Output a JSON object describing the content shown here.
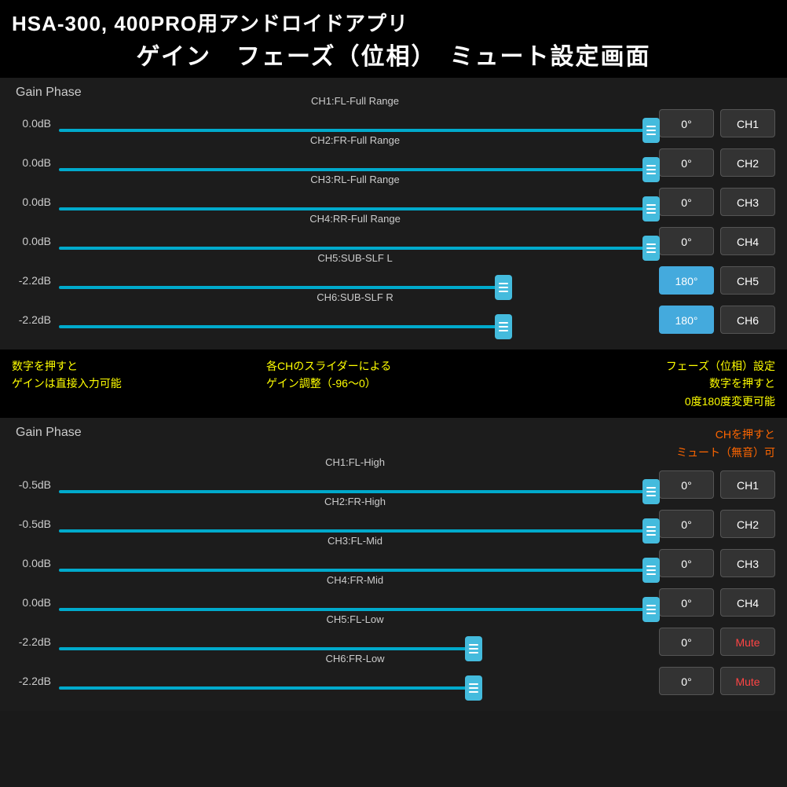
{
  "header": {
    "line1": "HSA-300, 400PRO用アンドロイドアプリ",
    "line2": "ゲイン　フェーズ（位相）　ミュート設定画面"
  },
  "section1": {
    "title": "Gain Phase",
    "channels": [
      {
        "id": "ch1",
        "gain": "0.0dB",
        "label": "CH1:FL-Full Range",
        "phase": "0°",
        "phaseActive": false,
        "chLabel": "CH1",
        "mute": false,
        "sliderType": "full"
      },
      {
        "id": "ch2",
        "gain": "0.0dB",
        "label": "CH2:FR-Full Range",
        "phase": "0°",
        "phaseActive": false,
        "chLabel": "CH2",
        "mute": false,
        "sliderType": "full"
      },
      {
        "id": "ch3",
        "gain": "0.0dB",
        "label": "CH3:RL-Full Range",
        "phase": "0°",
        "phaseActive": false,
        "chLabel": "CH3",
        "mute": false,
        "sliderType": "full"
      },
      {
        "id": "ch4",
        "gain": "0.0dB",
        "label": "CH4:RR-Full Range",
        "phase": "0°",
        "phaseActive": false,
        "chLabel": "CH4",
        "mute": false,
        "sliderType": "full"
      },
      {
        "id": "ch5",
        "gain": "-2.2dB",
        "label": "CH5:SUB-SLF L",
        "phase": "180°",
        "phaseActive": true,
        "chLabel": "CH5",
        "mute": false,
        "sliderType": "sub"
      },
      {
        "id": "ch6",
        "gain": "-2.2dB",
        "label": "CH6:SUB-SLF R",
        "phase": "180°",
        "phaseActive": true,
        "chLabel": "CH6",
        "mute": false,
        "sliderType": "sub"
      }
    ]
  },
  "infoBar": {
    "col1_line1": "数字を押すと",
    "col1_line2": "ゲインは直接入力可能",
    "col2_line1": "各CHのスライダーによる",
    "col2_line2": "ゲイン調整（-96〜0）",
    "col3_line1": "フェーズ（位相）設定",
    "col3_line2": "数字を押すと",
    "col3_line3": "0度180度変更可能"
  },
  "section2": {
    "title": "Gain Phase",
    "muteNote_line1": "CHを押すと",
    "muteNote_line2": "ミュート（無音）可",
    "channels": [
      {
        "id": "ch1b",
        "gain": "-0.5dB",
        "label": "CH1:FL-High",
        "phase": "0°",
        "phaseActive": false,
        "chLabel": "CH1",
        "mute": false,
        "sliderType": "full"
      },
      {
        "id": "ch2b",
        "gain": "-0.5dB",
        "label": "CH2:FR-High",
        "phase": "0°",
        "phaseActive": false,
        "chLabel": "CH2",
        "mute": false,
        "sliderType": "full"
      },
      {
        "id": "ch3b",
        "gain": "0.0dB",
        "label": "CH3:FL-Mid",
        "phase": "0°",
        "phaseActive": false,
        "chLabel": "CH3",
        "mute": false,
        "sliderType": "full"
      },
      {
        "id": "ch4b",
        "gain": "0.0dB",
        "label": "CH4:FR-Mid",
        "phase": "0°",
        "phaseActive": false,
        "chLabel": "CH4",
        "mute": false,
        "sliderType": "full"
      },
      {
        "id": "ch5b",
        "gain": "-2.2dB",
        "label": "CH5:FL-Low",
        "phase": "0°",
        "phaseActive": false,
        "chLabel": "Mute",
        "mute": true,
        "sliderType": "low"
      },
      {
        "id": "ch6b",
        "gain": "-2.2dB",
        "label": "CH6:FR-Low",
        "phase": "0°",
        "phaseActive": false,
        "chLabel": "Mute",
        "mute": true,
        "sliderType": "low"
      }
    ]
  }
}
